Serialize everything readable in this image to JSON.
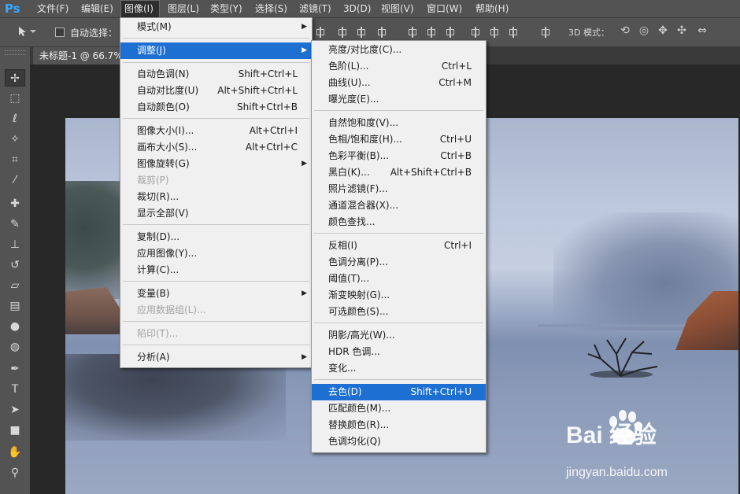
{
  "app": {
    "logo": "Ps"
  },
  "menubar": {
    "items": [
      "文件(F)",
      "编辑(E)",
      "图像(I)",
      "图层(L)",
      "类型(Y)",
      "选择(S)",
      "滤镜(T)",
      "3D(D)",
      "视图(V)",
      "窗口(W)",
      "帮助(H)"
    ]
  },
  "options": {
    "tool_icon": "move-arrow",
    "auto_select_label": "自动选择：",
    "auto_select_checked": false,
    "mode_label": "3D 模式："
  },
  "document": {
    "tab_title": "未标题-1 @ 66.7%"
  },
  "image_menu": {
    "items": [
      {
        "label": "模式(M)",
        "shortcut": "",
        "submenu": true
      },
      {
        "label": "调整(J)",
        "shortcut": "",
        "submenu": true,
        "highlighted": true
      },
      {
        "label": "自动色调(N)",
        "shortcut": "Shift+Ctrl+L"
      },
      {
        "label": "自动对比度(U)",
        "shortcut": "Alt+Shift+Ctrl+L"
      },
      {
        "label": "自动颜色(O)",
        "shortcut": "Shift+Ctrl+B"
      },
      {
        "label": "图像大小(I)...",
        "shortcut": "Alt+Ctrl+I"
      },
      {
        "label": "画布大小(S)...",
        "shortcut": "Alt+Ctrl+C"
      },
      {
        "label": "图像旋转(G)",
        "shortcut": "",
        "submenu": true
      },
      {
        "label": "裁剪(P)",
        "shortcut": "",
        "disabled": true
      },
      {
        "label": "裁切(R)...",
        "shortcut": ""
      },
      {
        "label": "显示全部(V)",
        "shortcut": ""
      },
      {
        "label": "复制(D)...",
        "shortcut": ""
      },
      {
        "label": "应用图像(Y)...",
        "shortcut": ""
      },
      {
        "label": "计算(C)...",
        "shortcut": ""
      },
      {
        "label": "变量(B)",
        "shortcut": "",
        "submenu": true
      },
      {
        "label": "应用数据组(L)...",
        "shortcut": "",
        "disabled": true
      },
      {
        "label": "陷印(T)...",
        "shortcut": "",
        "disabled": true
      },
      {
        "label": "分析(A)",
        "shortcut": "",
        "submenu": true
      }
    ]
  },
  "adjust_menu": {
    "items": [
      {
        "label": "亮度/对比度(C)...",
        "shortcut": ""
      },
      {
        "label": "色阶(L)...",
        "shortcut": "Ctrl+L"
      },
      {
        "label": "曲线(U)...",
        "shortcut": "Ctrl+M"
      },
      {
        "label": "曝光度(E)...",
        "shortcut": ""
      },
      {
        "label": "自然饱和度(V)...",
        "shortcut": ""
      },
      {
        "label": "色相/饱和度(H)...",
        "shortcut": "Ctrl+U"
      },
      {
        "label": "色彩平衡(B)...",
        "shortcut": "Ctrl+B"
      },
      {
        "label": "黑白(K)...",
        "shortcut": "Alt+Shift+Ctrl+B"
      },
      {
        "label": "照片滤镜(F)...",
        "shortcut": ""
      },
      {
        "label": "通道混合器(X)...",
        "shortcut": ""
      },
      {
        "label": "颜色查找...",
        "shortcut": ""
      },
      {
        "label": "反相(I)",
        "shortcut": "Ctrl+I"
      },
      {
        "label": "色调分离(P)...",
        "shortcut": ""
      },
      {
        "label": "阈值(T)...",
        "shortcut": ""
      },
      {
        "label": "渐变映射(G)...",
        "shortcut": ""
      },
      {
        "label": "可选颜色(S)...",
        "shortcut": ""
      },
      {
        "label": "阴影/高光(W)...",
        "shortcut": ""
      },
      {
        "label": "HDR 色调...",
        "shortcut": ""
      },
      {
        "label": "变化...",
        "shortcut": ""
      },
      {
        "label": "去色(D)",
        "shortcut": "Shift+Ctrl+U",
        "highlighted": true
      },
      {
        "label": "匹配颜色(M)...",
        "shortcut": ""
      },
      {
        "label": "替换颜色(R)...",
        "shortcut": ""
      },
      {
        "label": "色调均化(Q)",
        "shortcut": ""
      }
    ]
  },
  "watermark": {
    "brand": "Bai  经验",
    "site": "jingyan.baidu.com"
  },
  "colors": {
    "menu_highlight": "#1d6fd1",
    "ps_blue": "#38a8ff",
    "chrome": "#535353"
  }
}
